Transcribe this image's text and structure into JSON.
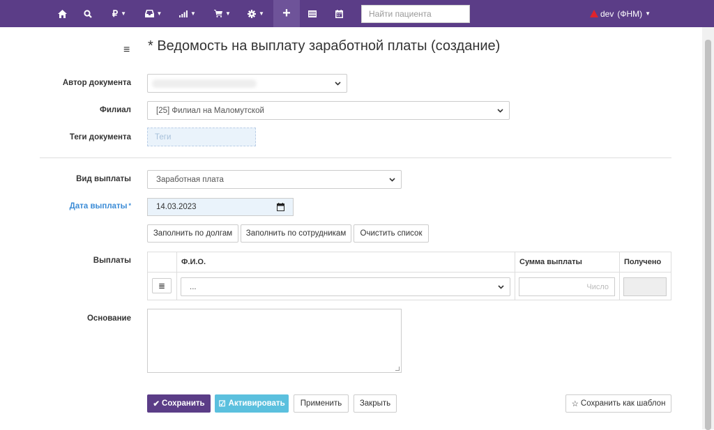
{
  "navbar": {
    "items": [
      {
        "icon": "home-icon"
      },
      {
        "icon": "search-icon"
      },
      {
        "icon": "ruble-icon",
        "label": "₽"
      },
      {
        "icon": "inbox-icon"
      },
      {
        "icon": "signal-icon"
      },
      {
        "icon": "cart-icon"
      },
      {
        "icon": "gear-icon"
      },
      {
        "icon": "plus-icon",
        "label": "+"
      },
      {
        "icon": "list-icon"
      },
      {
        "icon": "calendar-icon"
      }
    ],
    "search_placeholder": "Найти пациента",
    "user": "dev",
    "user_role": "(ФНМ)",
    "color": "#5b3d87"
  },
  "page": {
    "title": "* Ведомость на выплату заработной платы (создание)"
  },
  "form": {
    "author_label": "Автор документа",
    "author_value": "",
    "branch_label": "Филиал",
    "branch_value": "[25] Филиал на Маломутской",
    "tags_label": "Теги документа",
    "tags_placeholder": "Теги",
    "payment_type_label": "Вид выплаты",
    "payment_type_value": "Заработная плата",
    "payment_date_label": "Дата выплаты",
    "required_mark": "*",
    "payment_date_value": "14.03.2023",
    "fill_by_debts": "Заполнить по долгам",
    "fill_by_employees": "Заполнить по сотрудникам",
    "clear_list": "Очистить список",
    "payments_label": "Выплаты",
    "table": {
      "col_name": "Ф.И.О.",
      "col_sum": "Сумма выплаты",
      "col_received": "Получено",
      "row_name_value": "...",
      "row_sum_placeholder": "Число"
    },
    "basis_label": "Основание"
  },
  "actions": {
    "save": "Сохранить",
    "activate": "Активировать",
    "apply": "Применить",
    "close": "Закрыть",
    "save_template": "Сохранить как шаблон"
  }
}
